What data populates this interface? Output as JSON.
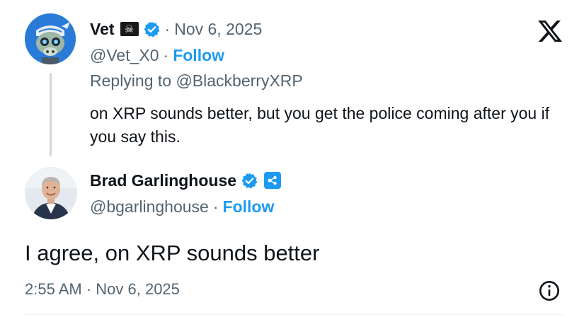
{
  "parent_tweet": {
    "author_name": "Vet",
    "badge_icon": "skull-crossbones-flag-icon",
    "date": "Nov 6, 2025",
    "separator": "·",
    "handle": "@Vet_X0",
    "follow_label": "Follow",
    "replying_to": "Replying to @BlackberryXRP",
    "text": "on XRP sounds better, but you get the police coming after you if you say this."
  },
  "main_tweet": {
    "author_name": "Brad Garlinghouse",
    "handle": "@bgarlinghouse",
    "separator": "·",
    "follow_label": "Follow",
    "text": "I agree, on XRP sounds better",
    "timestamp": "2:55 AM · Nov 6, 2025"
  },
  "colors": {
    "accent": "#1d9bf0",
    "secondary_text": "#536471",
    "primary_text": "#0f1419",
    "thread_line": "#cfd9de"
  },
  "icons": {
    "brand": "x-logo-icon",
    "verified": "verified-badge-icon",
    "affiliate": "ripple-affiliate-badge-icon",
    "info": "info-icon"
  }
}
